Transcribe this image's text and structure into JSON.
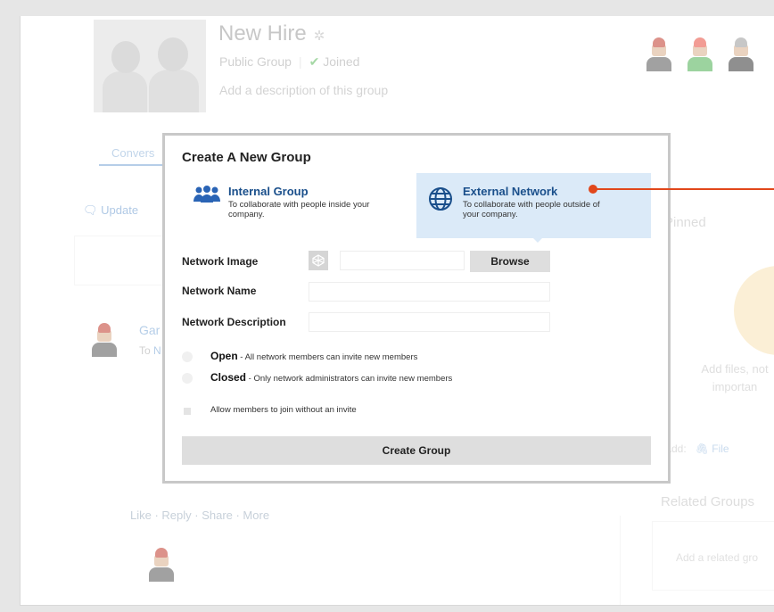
{
  "group": {
    "title": "New Hire",
    "visibility": "Public Group",
    "joined": "Joined",
    "description_placeholder": "Add a description of this group"
  },
  "tabs": {
    "conversations": "Convers"
  },
  "feed": {
    "update_label": "Update",
    "poster_name": "Gar",
    "poster_to": "To",
    "poster_to_name": "N",
    "actions": "Like · Reply · Share · More"
  },
  "right_panel": {
    "pinned": "Pinned",
    "add_files_line1": "Add files, not",
    "add_files_line2": "importan",
    "add_label": "Add:",
    "file_label": "File",
    "related_groups": "Related Groups",
    "related_hint": "Add a related gro"
  },
  "modal": {
    "title": "Create A New Group",
    "internal": {
      "label": "Internal Group",
      "desc": "To collaborate with people inside your company."
    },
    "external": {
      "label": "External Network",
      "desc": "To collaborate with people outside of your company."
    },
    "network_image_label": "Network Image",
    "browse_label": "Browse",
    "network_name_label": "Network Name",
    "network_description_label": "Network Description",
    "open_label": "Open",
    "open_desc": " - All network members can invite new members",
    "closed_label": "Closed",
    "closed_desc": " - Only network administrators can invite new members",
    "allow_join_label": "Allow members to join without an invite",
    "create_button": "Create Group",
    "selected_type": "external"
  },
  "colors": {
    "accent": "#1a4f8b",
    "selected_bg": "#dbeaf8",
    "callout": "#e1471b"
  }
}
